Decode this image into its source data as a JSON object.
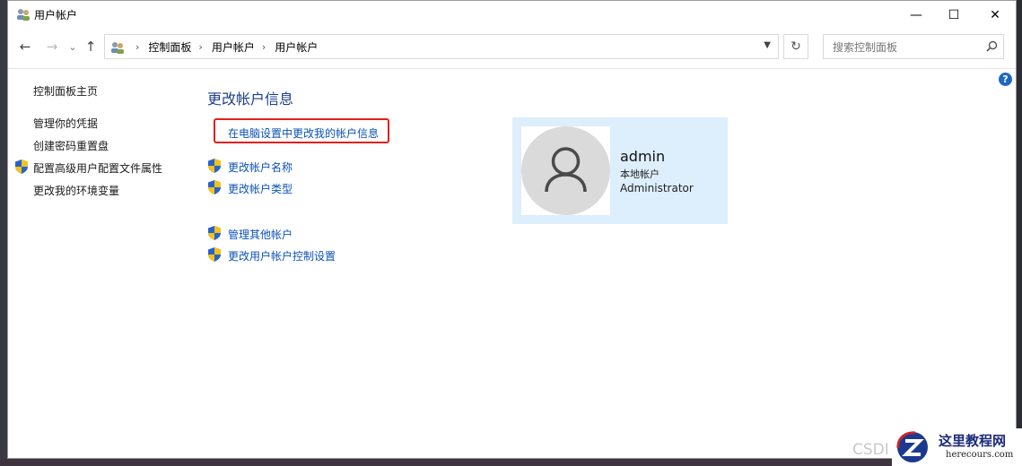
{
  "window": {
    "title": "用户帐户",
    "controls": {
      "minimize": "—",
      "maximize": "☐",
      "close": "✕"
    }
  },
  "nav": {
    "back": "←",
    "forward": "→",
    "recent": "⌄",
    "up": "↑"
  },
  "breadcrumb": [
    "控制面板",
    "用户帐户",
    "用户帐户"
  ],
  "breadcrumb_separator": "›",
  "search": {
    "placeholder": "搜索控制面板"
  },
  "sidebar": {
    "items": [
      {
        "label": "控制面板主页",
        "shield": false
      },
      {
        "label": "管理你的凭据",
        "shield": false
      },
      {
        "label": "创建密码重置盘",
        "shield": false
      },
      {
        "label": "配置高级用户配置文件属性",
        "shield": true
      },
      {
        "label": "更改我的环境变量",
        "shield": false
      }
    ]
  },
  "main": {
    "heading": "更改帐户信息",
    "highlight_link": "在电脑设置中更改我的帐户信息",
    "links": [
      {
        "label": "更改帐户名称",
        "shield": true
      },
      {
        "label": "更改帐户类型",
        "shield": true
      },
      {
        "label": "管理其他帐户",
        "shield": true
      },
      {
        "label": "更改用户帐户控制设置",
        "shield": true
      }
    ]
  },
  "account": {
    "name": "admin",
    "type": "本地帐户",
    "role": "Administrator"
  },
  "watermarks": {
    "csdn": "CSDI",
    "site_title": "这里教程网",
    "site_url": "herecours.com"
  },
  "colors": {
    "link": "#0b52b8",
    "heading": "#1e3f8c",
    "highlight_border": "#e0211a",
    "card_bg": "#ddeefd"
  }
}
